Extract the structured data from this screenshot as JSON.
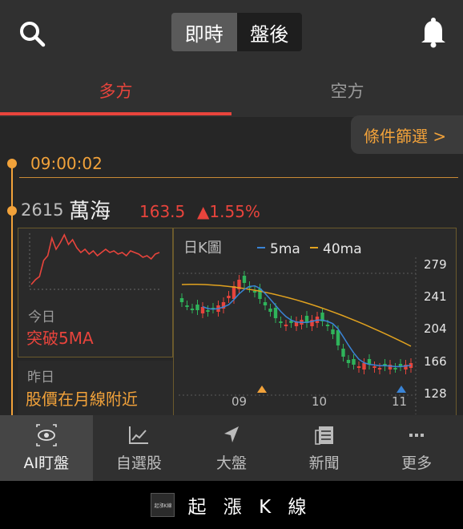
{
  "header": {
    "mode_tabs": [
      "即時",
      "盤後"
    ],
    "active_mode": "即時"
  },
  "direction_tabs": [
    "多方",
    "空方"
  ],
  "filter_button": "條件篩選 >",
  "timeline": {
    "time": "09:00:02"
  },
  "stock": {
    "code": "2615",
    "name": "萬海",
    "price": "163.5",
    "change": "▲1.55%",
    "reasons": [
      {
        "label": "今日",
        "text": "突破5MA"
      },
      {
        "label": "昨日",
        "text": "股價在月線附近"
      }
    ]
  },
  "kline": {
    "title": "日K圖",
    "legend": [
      "5ma",
      "40ma"
    ],
    "y_ticks": [
      "279",
      "241",
      "204",
      "166",
      "128"
    ],
    "x_ticks": [
      "09",
      "10",
      "11"
    ]
  },
  "colors": {
    "up": "#e8443c",
    "down": "#2fb35a",
    "accent": "#f2a23a",
    "ma5": "#3a84d6",
    "ma40": "#e1a21f"
  },
  "bottom_nav": [
    {
      "label": "AI盯盤",
      "icon": "eye-icon"
    },
    {
      "label": "自選股",
      "icon": "chart-icon"
    },
    {
      "label": "大盤",
      "icon": "navigation-arrow-icon"
    },
    {
      "label": "新聞",
      "icon": "newspaper-icon"
    },
    {
      "label": "更多",
      "icon": "more-icon"
    }
  ],
  "footer": {
    "brand": "起 漲 K 線",
    "logo_text": "起漲K線"
  }
}
